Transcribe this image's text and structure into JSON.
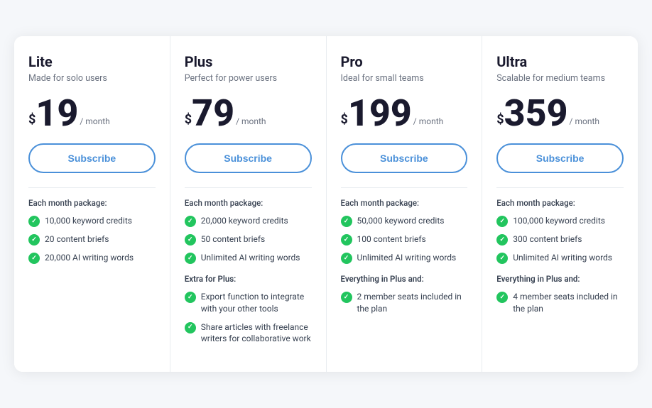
{
  "plans": [
    {
      "id": "lite",
      "name": "Lite",
      "subtitle": "Made for solo users",
      "currency": "$",
      "price": "19",
      "period": "/ month",
      "subscribe_label": "Subscribe",
      "monthly_label": "Each month package:",
      "monthly_features": [
        "10,000 keyword credits",
        "20 content briefs",
        "20,000 AI writing words"
      ],
      "extra_label": "",
      "extra_features": []
    },
    {
      "id": "plus",
      "name": "Plus",
      "subtitle": "Perfect for power users",
      "currency": "$",
      "price": "79",
      "period": "/ month",
      "subscribe_label": "Subscribe",
      "monthly_label": "Each month package:",
      "monthly_features": [
        "20,000 keyword credits",
        "50 content briefs",
        "Unlimited AI writing words"
      ],
      "extra_label": "Extra for Plus:",
      "extra_features": [
        "Export function to integrate with your other tools",
        "Share articles with freelance writers for collaborative work"
      ]
    },
    {
      "id": "pro",
      "name": "Pro",
      "subtitle": "Ideal for small teams",
      "currency": "$",
      "price": "199",
      "period": "/ month",
      "subscribe_label": "Subscribe",
      "monthly_label": "Each month package:",
      "monthly_features": [
        "50,000 keyword credits",
        "100 content briefs",
        "Unlimited AI writing words"
      ],
      "extra_label": "Everything in Plus and:",
      "extra_features": [
        "2 member seats included in the plan"
      ]
    },
    {
      "id": "ultra",
      "name": "Ultra",
      "subtitle": "Scalable for medium teams",
      "currency": "$",
      "price": "359",
      "period": "/ month",
      "subscribe_label": "Subscribe",
      "monthly_label": "Each month package:",
      "monthly_features": [
        "100,000 keyword credits",
        "300 content briefs",
        "Unlimited AI writing words"
      ],
      "extra_label": "Everything in Plus and:",
      "extra_features": [
        "4 member seats included in the plan"
      ]
    }
  ]
}
